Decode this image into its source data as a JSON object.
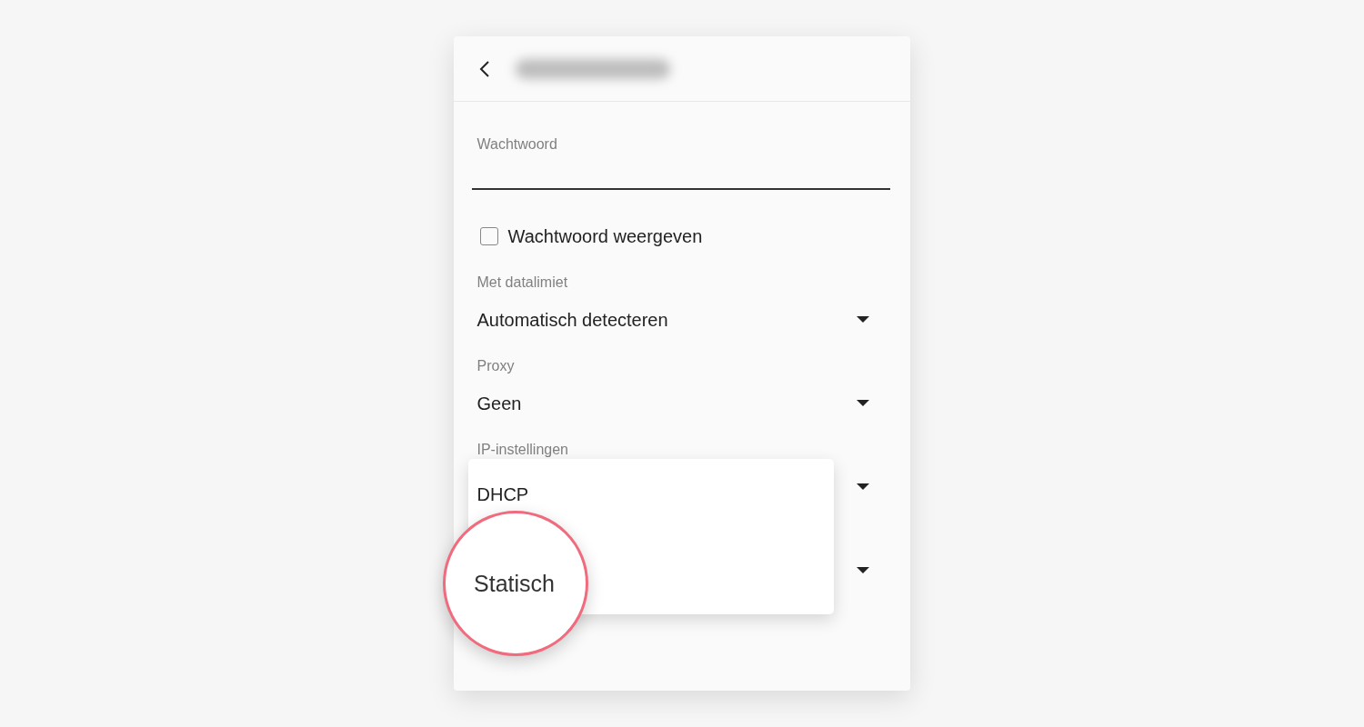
{
  "password": {
    "label": "Wachtwoord"
  },
  "show_password": {
    "label": "Wachtwoord weergeven",
    "checked": false
  },
  "selects": [
    {
      "kind": "select",
      "label": "Met datalimiet",
      "value": "Automatisch detecteren"
    },
    {
      "kind": "select",
      "label": "Proxy",
      "value": "Geen"
    },
    {
      "kind": "select",
      "label": "IP-instellingen"
    },
    {
      "kind": "covered"
    }
  ],
  "menu": {
    "options": [
      {
        "label": "DHCP",
        "highlighted": false
      },
      {
        "label": "Statisch",
        "highlighted": true
      }
    ]
  }
}
